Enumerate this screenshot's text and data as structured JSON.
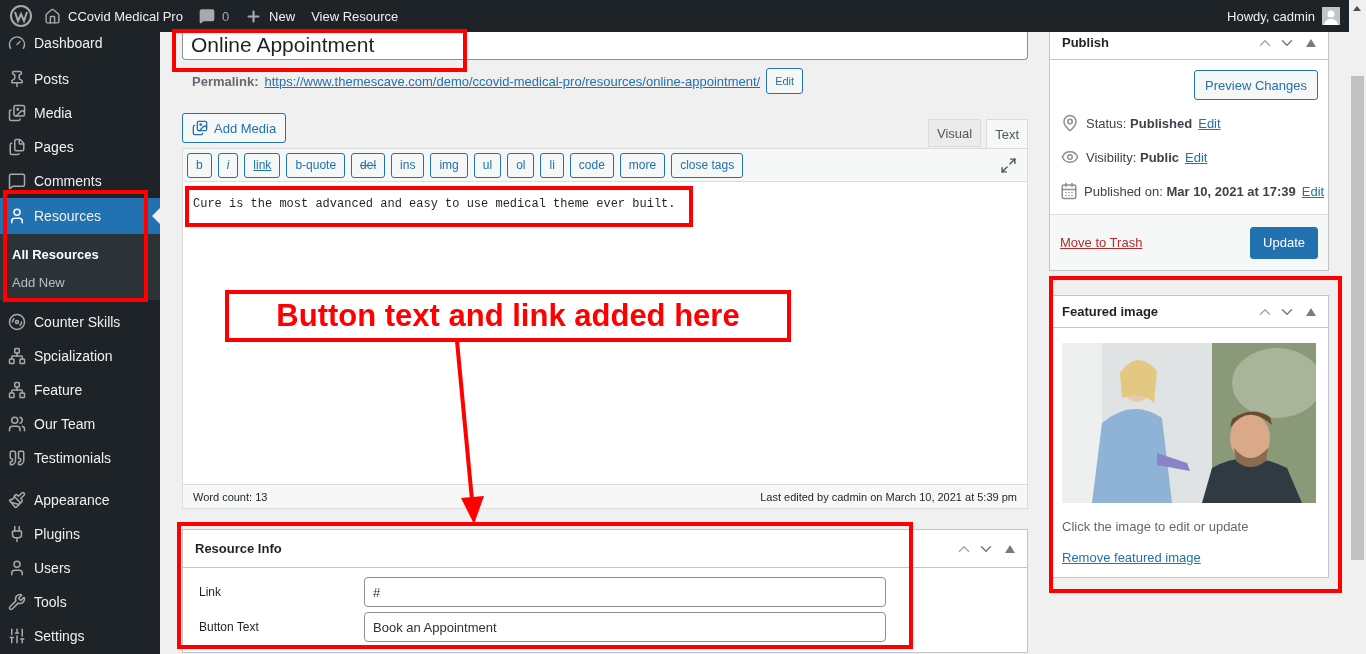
{
  "admin_bar": {
    "site_name": "CCovid Medical Pro",
    "comments_count": "0",
    "new_label": "New",
    "view_label": "View Resource",
    "greeting": "Howdy, cadmin"
  },
  "sidebar": {
    "groups": [
      [
        {
          "label": "Dashboard",
          "selected": false
        }
      ],
      [
        {
          "label": "Posts",
          "selected": false
        },
        {
          "label": "Media",
          "selected": false
        },
        {
          "label": "Pages",
          "selected": false
        },
        {
          "label": "Comments",
          "selected": false
        },
        {
          "label": "Resources",
          "selected": true,
          "children": [
            {
              "label": "All Resources",
              "selected": true
            },
            {
              "label": "Add New",
              "selected": false
            }
          ]
        },
        {
          "label": "Counter Skills",
          "selected": false
        },
        {
          "label": "Spcialization",
          "selected": false
        },
        {
          "label": "Feature",
          "selected": false
        },
        {
          "label": "Our Team",
          "selected": false
        },
        {
          "label": "Testimonials",
          "selected": false
        }
      ],
      [
        {
          "label": "Appearance",
          "selected": false
        },
        {
          "label": "Plugins",
          "selected": false
        },
        {
          "label": "Users",
          "selected": false
        },
        {
          "label": "Tools",
          "selected": false
        },
        {
          "label": "Settings",
          "selected": false
        }
      ]
    ]
  },
  "editor": {
    "title": "Online Appointment",
    "permalink_label": "Permalink:",
    "permalink_url": "https://www.themescave.com/demo/ccovid-medical-pro/resources/online-appointment/",
    "edit_button": "Edit",
    "add_media": "Add Media",
    "tabs": [
      {
        "label": "Visual",
        "selected": false
      },
      {
        "label": "Text",
        "selected": true
      }
    ],
    "quicktags": [
      {
        "label": "b",
        "kind": "plain"
      },
      {
        "label": "i",
        "kind": "italic"
      },
      {
        "label": "link",
        "kind": "underline"
      },
      {
        "label": "b-quote",
        "kind": "plain"
      },
      {
        "label": "del",
        "kind": "strike"
      },
      {
        "label": "ins",
        "kind": "plain"
      },
      {
        "label": "img",
        "kind": "plain"
      },
      {
        "label": "ul",
        "kind": "plain"
      },
      {
        "label": "ol",
        "kind": "plain"
      },
      {
        "label": "li",
        "kind": "plain"
      },
      {
        "label": "code",
        "kind": "plain"
      },
      {
        "label": "more",
        "kind": "plain"
      },
      {
        "label": "close tags",
        "kind": "plain"
      }
    ],
    "content": "Cure is the most advanced and easy to use medical theme ever built.",
    "word_count": "Word count: 13",
    "last_edited": "Last edited by cadmin on March 10, 2021 at 5:39 pm"
  },
  "resource_info": {
    "title": "Resource Info",
    "fields": [
      {
        "label": "Link",
        "value": "#"
      },
      {
        "label": "Button Text",
        "value": "Book an Appointment"
      }
    ]
  },
  "publish": {
    "title": "Publish",
    "preview_button": "Preview Changes",
    "rows": [
      {
        "label": "Status:",
        "value": "Published",
        "action": "Edit"
      },
      {
        "label": "Visibility:",
        "value": "Public",
        "action": "Edit"
      },
      {
        "label": "Published on:",
        "value": "Mar 10, 2021 at 17:39",
        "action": "Edit"
      }
    ],
    "trash_link": "Move to Trash",
    "update_button": "Update"
  },
  "featured_image": {
    "title": "Featured image",
    "hint": "Click the image to edit or update",
    "remove_link": "Remove featured image"
  },
  "annotation": {
    "callout": "Button text and link added here"
  }
}
